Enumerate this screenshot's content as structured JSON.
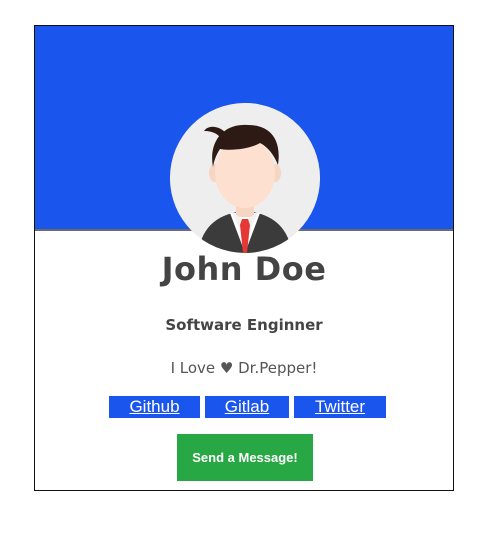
{
  "colors": {
    "banner": "#1a56ee",
    "link_bg": "#1a56ee",
    "button_bg": "#28a745",
    "text": "#444444"
  },
  "profile": {
    "name": "John Doe",
    "title": "Software Enginner",
    "bio": "I Love ♥ Dr.Pepper!",
    "avatar_icon": "man-avatar-icon"
  },
  "links": [
    {
      "label": "Github"
    },
    {
      "label": "Gitlab"
    },
    {
      "label": "Twitter"
    }
  ],
  "action": {
    "message_label": "Send a Message!"
  }
}
